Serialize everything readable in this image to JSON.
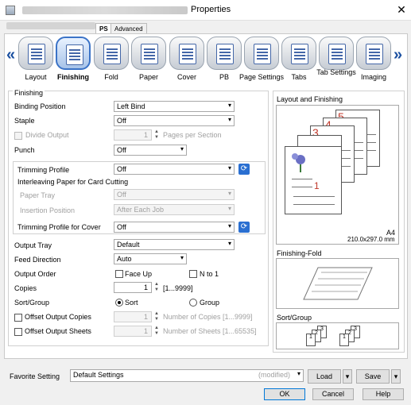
{
  "window": {
    "title": "Properties"
  },
  "tabs": [
    {
      "label": "PS"
    },
    {
      "label": "Advanced"
    }
  ],
  "categories": [
    {
      "label": "Layout",
      "icon": "layout-icon"
    },
    {
      "label": "Finishing",
      "icon": "finishing-icon"
    },
    {
      "label": "Fold",
      "icon": "fold-icon"
    },
    {
      "label": "Paper",
      "icon": "paper-icon"
    },
    {
      "label": "Cover",
      "icon": "cover-icon"
    },
    {
      "label": "PB",
      "icon": "perfect-binding-icon"
    },
    {
      "label": "Page Settings",
      "icon": "page-settings-icon"
    },
    {
      "label": "Tabs",
      "icon": "tabs-icon"
    },
    {
      "label": "Tab Settings",
      "icon": "tab-settings-icon"
    },
    {
      "label": "Imaging",
      "icon": "imaging-icon"
    }
  ],
  "finishing": {
    "section_title": "Finishing",
    "binding_position": {
      "label": "Binding Position",
      "value": "Left Bind"
    },
    "staple": {
      "label": "Staple",
      "value": "Off"
    },
    "divide_output": {
      "label": "Divide Output",
      "value": "1",
      "suffix": "Pages per Section"
    },
    "punch": {
      "label": "Punch",
      "value": "Off"
    },
    "trimming_profile": {
      "label": "Trimming Profile",
      "value": "Off"
    },
    "interleaving": {
      "label": "Interleaving Paper for Card Cutting"
    },
    "paper_tray": {
      "label": "Paper Tray",
      "value": "Off"
    },
    "insertion_position": {
      "label": "Insertion Position",
      "value": "After Each Job"
    },
    "trimming_cover": {
      "label": "Trimming Profile for Cover",
      "value": "Off"
    },
    "output_tray": {
      "label": "Output Tray",
      "value": "Default"
    },
    "feed_direction": {
      "label": "Feed Direction",
      "value": "Auto"
    },
    "output_order": {
      "label": "Output Order",
      "face_up": "Face Up",
      "n_to_1": "N to 1"
    },
    "copies": {
      "label": "Copies",
      "value": "1",
      "range": "[1...9999]"
    },
    "sort_group": {
      "label": "Sort/Group",
      "sort": "Sort",
      "group": "Group"
    },
    "offset_copies": {
      "label": "Offset Output Copies",
      "value": "1",
      "suffix": "Number of Copies [1...9999]"
    },
    "offset_sheets": {
      "label": "Offset Output Sheets",
      "value": "1",
      "suffix": "Number of Sheets [1...65535]"
    }
  },
  "preview": {
    "layout_title": "Layout and Finishing",
    "page_numbers": [
      "5",
      "4",
      "3",
      "2",
      "1"
    ],
    "paper_size": "A4",
    "paper_dims": "210.0x297.0 mm",
    "fold_title": "Finishing-Fold",
    "sortgroup_title": "Sort/Group",
    "sort_pages": [
      "3",
      "2",
      "1",
      "3",
      "2",
      "1"
    ]
  },
  "favorite": {
    "label": "Favorite Setting",
    "value": "Default Settings",
    "modified": "(modified)",
    "load": "Load",
    "save": "Save"
  },
  "footer": {
    "ok": "OK",
    "cancel": "Cancel",
    "help": "Help"
  },
  "colors": {
    "accent": "#3b73c7",
    "nav_arrow": "#1a4fa0",
    "page_number": "#c0392b"
  }
}
